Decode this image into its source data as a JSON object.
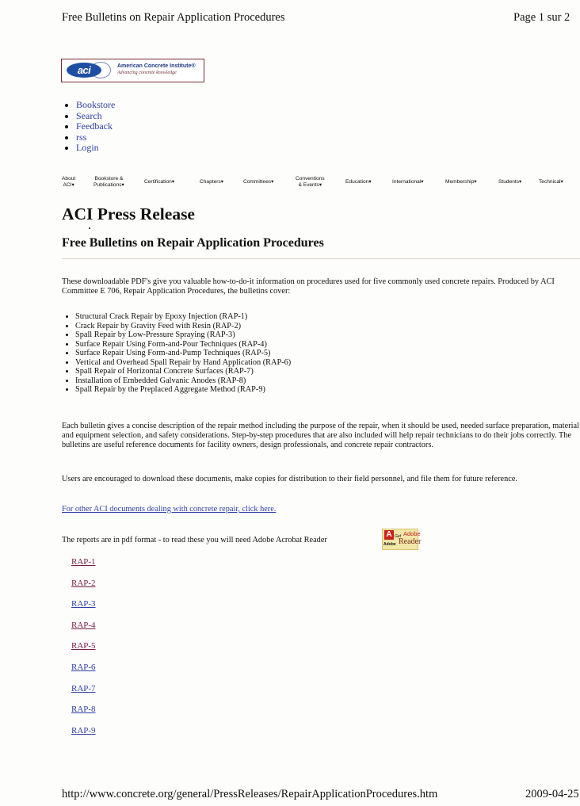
{
  "header": {
    "title": "Free Bulletins on Repair Application Procedures",
    "page": "Page 1 sur 2"
  },
  "logo": {
    "mark": "aci",
    "name": "American Concrete Institute®",
    "tagline": "Advancing concrete knowledge"
  },
  "top_links": [
    "Bookstore",
    "Search",
    "Feedback",
    "rss",
    "Login"
  ],
  "nav": [
    [
      "About",
      "ACI▾"
    ],
    [
      "Bookstore &",
      "Publications▾"
    ],
    [
      "Certification▾"
    ],
    [
      "Chapters▾"
    ],
    [
      "Committees▾"
    ],
    [
      "Conventions",
      "& Events▾"
    ],
    [
      "Education▾"
    ],
    [
      "International▾"
    ],
    [
      "Membership▾"
    ],
    [
      "Students▾"
    ],
    [
      "Technical▾"
    ]
  ],
  "page_title": "ACI Press Release",
  "subtitle": "Free Bulletins on Repair Application Procedures",
  "intro": "These downloadable PDF's give you valuable how-to-do-it information on procedures used for five commonly used concrete repairs. Produced by ACI Committee E 706, Repair Application Procedures, the bulletins cover:",
  "bulletins": [
    "Structural Crack Repair by Epoxy Injection (RAP-1)",
    "Crack Repair by Gravity Feed with Resin (RAP-2)",
    "Spall Repair by Low-Pressure Spraying (RAP-3)",
    "Surface Repair Using Form-and-Pour Techniques (RAP-4)",
    "Surface Repair Using Form-and-Pump Techniques (RAP-5)",
    "Vertical and Overhead Spall Repair by Hand Application (RAP-6)",
    "Spall Repair of Horizontal Concrete Surfaces (RAP-7)",
    "Installation of Embedded Galvanic Anodes (RAP-8)",
    "Spall Repair by the Preplaced Aggregate Method (RAP-9)"
  ],
  "para2": "Each bulletin gives a concise description of the repair method including the purpose of the repair, when it should be used, needed surface preparation, material and equipment selection, and safety considerations. Step-by-step procedures that are also included will help repair technicians to do their jobs correctly. The bulletins are useful reference documents for facility owners, design professionals, and concrete repair contractors.",
  "para3": "Users are encouraged to download these documents, make copies for distribution to their field personnel, and file them for future reference.",
  "other_link": "For other ACI documents dealing with concrete repair, click here.",
  "reader_note": "The reports are in pdf format - to read these you will need Adobe Acrobat Reader",
  "adobe_badge": {
    "brand": "Adobe",
    "get": "Get",
    "product_brand": "Adobe",
    "product": "Reader"
  },
  "rap_links": [
    {
      "label": "RAP-1",
      "visited": true
    },
    {
      "label": "RAP-2",
      "visited": true
    },
    {
      "label": "RAP-3",
      "visited": false
    },
    {
      "label": "RAP-4",
      "visited": true
    },
    {
      "label": "RAP-5",
      "visited": true
    },
    {
      "label": "RAP-6",
      "visited": false
    },
    {
      "label": "RAP-7",
      "visited": false
    },
    {
      "label": "RAP-8",
      "visited": false
    },
    {
      "label": "RAP-9",
      "visited": false
    }
  ],
  "footer": {
    "url": "http://www.concrete.org/general/PressReleases/RepairApplicationProcedures.htm",
    "date": "2009-04-25"
  },
  "colors": {
    "link": "#2e3fa8",
    "visited_link": "#7a2048",
    "logo_blue": "#1e4fa3",
    "logo_border": "#7a2a35"
  }
}
